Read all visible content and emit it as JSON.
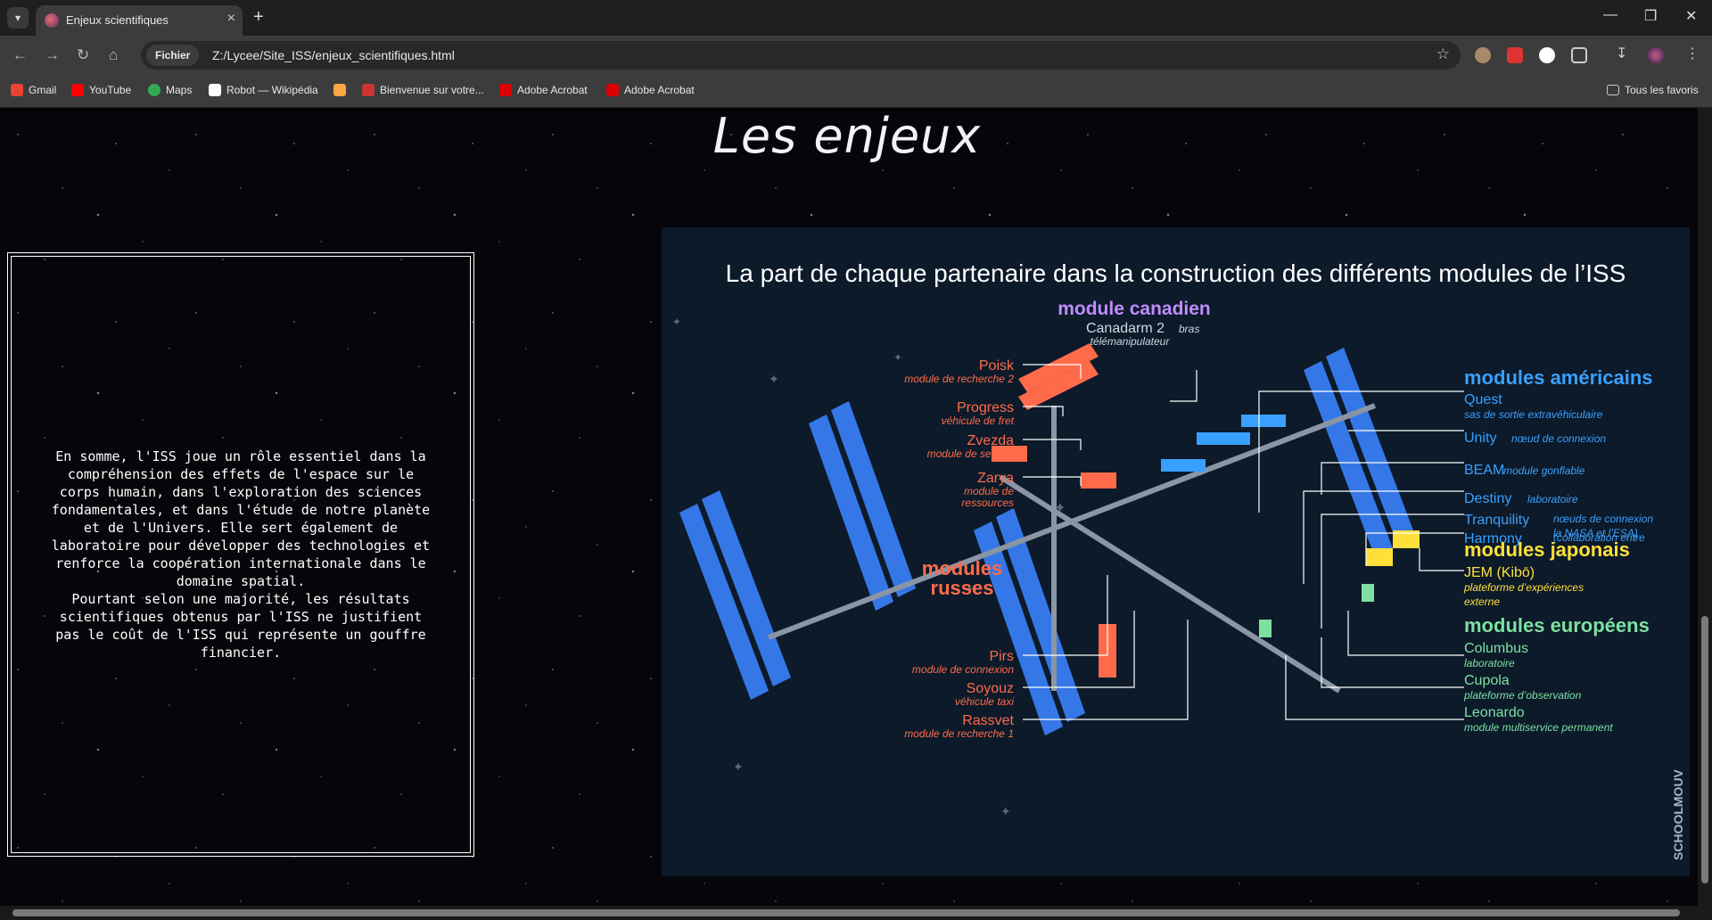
{
  "browser": {
    "tab_title": "Enjeux scientifiques",
    "omnibox_chip": "Fichier",
    "url": "Z:/Lycee/Site_ISS/enjeux_scientifiques.html",
    "bookmarks": [
      "Gmail",
      "YouTube",
      "Maps",
      "Robot — Wikipédia",
      "Bienvenue sur votre...",
      "Adobe Acrobat",
      "Adobe Acrobat"
    ],
    "all_bookmarks": "Tous les favoris"
  },
  "page": {
    "title": "Les enjeux",
    "paragraph": "En somme, l'ISS joue un rôle essentiel dans la compréhension des effets de l'espace sur le corps humain, dans l'exploration des sciences fondamentales, et dans l'étude de notre planète et de l'Univers. Elle sert également de laboratoire pour développer des technologies et renforce la coopération internationale dans le domaine spatial.\nPourtant selon une majorité, les résultats scientifiques obtenus par l'ISS ne justifient pas le coût de l'ISS qui représente un gouffre financier."
  },
  "infographic": {
    "title": "La part de chaque partenaire dans la construction des différents modules de l’ISS",
    "canadian": {
      "heading": "module canadien",
      "name": "Canadarm 2",
      "name_suffix": "bras",
      "desc": "télémanipulateur"
    },
    "russian_heading_1": "modules",
    "russian_heading_2": "russes",
    "russian": [
      {
        "name": "Poisk",
        "desc": "module de recherche 2"
      },
      {
        "name": "Progress",
        "desc": "véhicule de fret"
      },
      {
        "name": "Zvezda",
        "desc": "module de service"
      },
      {
        "name": "Zarya",
        "desc": "module de",
        "desc2": "ressources"
      },
      {
        "name": "Pirs",
        "desc": "module de connexion"
      },
      {
        "name": "Soyouz",
        "desc": "véhicule taxi"
      },
      {
        "name": "Rassvet",
        "desc": "module de recherche 1"
      }
    ],
    "american_heading": "modules américains",
    "american": [
      {
        "name": "Quest",
        "desc": "sas de sortie extravéhiculaire"
      },
      {
        "name": "Unity",
        "desc": "nœud de connexion"
      },
      {
        "name": "BEAM",
        "desc": "module gonflable"
      },
      {
        "name": "Destiny",
        "desc": "laboratoire"
      },
      {
        "name": "Tranquility",
        "desc": "nœuds de connexion"
      },
      {
        "name": "Harmony",
        "desc": "(collaboration entre"
      }
    ],
    "american_note": "la NASA et l’ESA)",
    "japanese_heading": "modules japonais",
    "japanese": {
      "name": "JEM (Kibō)",
      "desc": "plateforme d’expériences",
      "desc2": "externe"
    },
    "european_heading": "modules européens",
    "european": [
      {
        "name": "Columbus",
        "desc": "laboratoire"
      },
      {
        "name": "Cupola",
        "desc": "plateforme d’observation"
      },
      {
        "name": "Leonardo",
        "desc": "module multiservice permanent"
      }
    ],
    "credit": "SCHOOLMOUV",
    "colors": {
      "russian": "#ff6b4a",
      "american": "#3aa0ff",
      "japanese": "#ffe03a",
      "european": "#7ee0a0",
      "canadian": "#c08cff",
      "panel": "#3577e6"
    }
  }
}
